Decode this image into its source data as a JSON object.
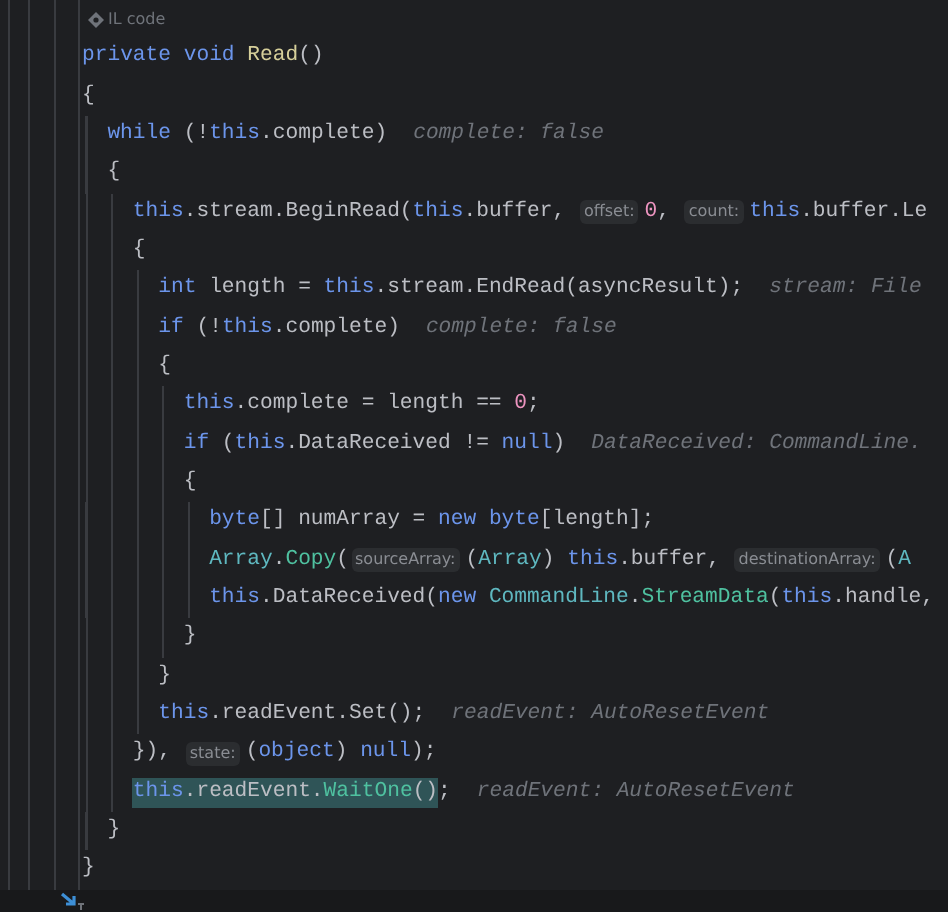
{
  "editor": {
    "code_vision": {
      "text": "IL code"
    },
    "lines": [
      {
        "segments": [
          {
            "kind": "code",
            "tokens": [
              {
                "kind": "kw",
                "text": "private void "
              },
              {
                "kind": "decl",
                "text": "Read"
              },
              {
                "kind": "plain",
                "text": "()"
              }
            ]
          }
        ]
      },
      {
        "segments": [
          {
            "kind": "code",
            "tokens": [
              {
                "kind": "plain",
                "text": "{"
              }
            ]
          }
        ],
        "children": [
          {
            "segments": [
              {
                "kind": "code",
                "tokens": [
                  {
                    "kind": "kw",
                    "text": "while "
                  },
                  {
                    "kind": "plain",
                    "text": "(!"
                  },
                  {
                    "kind": "kw",
                    "text": "this"
                  },
                  {
                    "kind": "plain",
                    "text": ".complete)"
                  }
                ]
              },
              {
                "kind": "value-hint",
                "text": "complete: false"
              }
            ]
          },
          {
            "segments": [
              {
                "kind": "code",
                "tokens": [
                  {
                    "kind": "plain",
                    "text": "{"
                  }
                ]
              }
            ],
            "children": [
              {
                "segments": [
                  {
                    "kind": "code",
                    "tokens": [
                      {
                        "kind": "kw",
                        "text": "this"
                      },
                      {
                        "kind": "plain",
                        "text": ".stream.BeginRead("
                      },
                      {
                        "kind": "kw",
                        "text": "this"
                      },
                      {
                        "kind": "plain",
                        "text": ".buffer, "
                      }
                    ]
                  },
                  {
                    "kind": "param-hint",
                    "text": "offset:"
                  },
                  {
                    "kind": "code",
                    "tokens": [
                      {
                        "kind": "num",
                        "text": "0"
                      },
                      {
                        "kind": "plain",
                        "text": ", "
                      }
                    ]
                  },
                  {
                    "kind": "param-hint",
                    "text": "count:"
                  },
                  {
                    "kind": "code",
                    "tokens": [
                      {
                        "kind": "kw",
                        "text": "this"
                      },
                      {
                        "kind": "plain",
                        "text": ".buffer.Le"
                      }
                    ]
                  }
                ]
              },
              {
                "segments": [
                  {
                    "kind": "code",
                    "tokens": [
                      {
                        "kind": "plain",
                        "text": "{"
                      }
                    ]
                  }
                ],
                "children": [
                  {
                    "segments": [
                      {
                        "kind": "code",
                        "tokens": [
                          {
                            "kind": "kw",
                            "text": "int "
                          },
                          {
                            "kind": "plain",
                            "text": "length = "
                          },
                          {
                            "kind": "kw",
                            "text": "this"
                          },
                          {
                            "kind": "plain",
                            "text": ".stream.EndRead(asyncResult);"
                          }
                        ]
                      },
                      {
                        "kind": "value-hint",
                        "text": "stream: File"
                      }
                    ]
                  },
                  {
                    "segments": [
                      {
                        "kind": "code",
                        "tokens": [
                          {
                            "kind": "kw",
                            "text": "if "
                          },
                          {
                            "kind": "plain",
                            "text": "(!"
                          },
                          {
                            "kind": "kw",
                            "text": "this"
                          },
                          {
                            "kind": "plain",
                            "text": ".complete)"
                          }
                        ]
                      },
                      {
                        "kind": "value-hint",
                        "text": "complete: false"
                      }
                    ]
                  },
                  {
                    "segments": [
                      {
                        "kind": "code",
                        "tokens": [
                          {
                            "kind": "plain",
                            "text": "{"
                          }
                        ]
                      }
                    ],
                    "children": [
                      {
                        "segments": [
                          {
                            "kind": "code",
                            "tokens": [
                              {
                                "kind": "kw",
                                "text": "this"
                              },
                              {
                                "kind": "plain",
                                "text": ".complete = length == "
                              },
                              {
                                "kind": "num",
                                "text": "0"
                              },
                              {
                                "kind": "plain",
                                "text": ";"
                              }
                            ]
                          }
                        ]
                      },
                      {
                        "segments": [
                          {
                            "kind": "code",
                            "tokens": [
                              {
                                "kind": "kw",
                                "text": "if "
                              },
                              {
                                "kind": "plain",
                                "text": "("
                              },
                              {
                                "kind": "kw",
                                "text": "this"
                              },
                              {
                                "kind": "plain",
                                "text": ".DataReceived != "
                              },
                              {
                                "kind": "kw",
                                "text": "null"
                              },
                              {
                                "kind": "plain",
                                "text": ")"
                              }
                            ]
                          },
                          {
                            "kind": "value-hint",
                            "text": "DataReceived: CommandLine."
                          }
                        ]
                      },
                      {
                        "segments": [
                          {
                            "kind": "code",
                            "tokens": [
                              {
                                "kind": "plain",
                                "text": "{"
                              }
                            ]
                          }
                        ],
                        "children": [
                          {
                            "segments": [
                              {
                                "kind": "code",
                                "tokens": [
                                  {
                                    "kind": "kw",
                                    "text": "byte"
                                  },
                                  {
                                    "kind": "plain",
                                    "text": "[] numArray = "
                                  },
                                  {
                                    "kind": "kw",
                                    "text": "new byte"
                                  },
                                  {
                                    "kind": "plain",
                                    "text": "[length];"
                                  }
                                ]
                              }
                            ]
                          },
                          {
                            "segments": [
                              {
                                "kind": "code",
                                "tokens": [
                                  {
                                    "kind": "type",
                                    "text": "Array"
                                  },
                                  {
                                    "kind": "plain",
                                    "text": "."
                                  },
                                  {
                                    "kind": "call",
                                    "text": "Copy"
                                  },
                                  {
                                    "kind": "plain",
                                    "text": "("
                                  }
                                ]
                              },
                              {
                                "kind": "param-hint",
                                "text": "sourceArray:"
                              },
                              {
                                "kind": "code",
                                "tokens": [
                                  {
                                    "kind": "plain",
                                    "text": "("
                                  },
                                  {
                                    "kind": "type",
                                    "text": "Array"
                                  },
                                  {
                                    "kind": "plain",
                                    "text": ") "
                                  },
                                  {
                                    "kind": "kw",
                                    "text": "this"
                                  },
                                  {
                                    "kind": "plain",
                                    "text": ".buffer, "
                                  }
                                ]
                              },
                              {
                                "kind": "param-hint",
                                "text": "destinationArray:"
                              },
                              {
                                "kind": "code",
                                "tokens": [
                                  {
                                    "kind": "plain",
                                    "text": "("
                                  },
                                  {
                                    "kind": "type",
                                    "text": "A"
                                  }
                                ]
                              }
                            ]
                          },
                          {
                            "segments": [
                              {
                                "kind": "code",
                                "tokens": [
                                  {
                                    "kind": "kw",
                                    "text": "this"
                                  },
                                  {
                                    "kind": "plain",
                                    "text": ".DataReceived("
                                  },
                                  {
                                    "kind": "kw",
                                    "text": "new "
                                  },
                                  {
                                    "kind": "type",
                                    "text": "CommandLine"
                                  },
                                  {
                                    "kind": "plain",
                                    "text": "."
                                  },
                                  {
                                    "kind": "call",
                                    "text": "StreamData"
                                  },
                                  {
                                    "kind": "plain",
                                    "text": "("
                                  },
                                  {
                                    "kind": "kw",
                                    "text": "this"
                                  },
                                  {
                                    "kind": "plain",
                                    "text": ".handle,"
                                  }
                                ]
                              }
                            ]
                          }
                        ]
                      },
                      {
                        "segments": [
                          {
                            "kind": "code",
                            "tokens": [
                              {
                                "kind": "plain",
                                "text": "}"
                              }
                            ]
                          }
                        ]
                      }
                    ]
                  },
                  {
                    "segments": [
                      {
                        "kind": "code",
                        "tokens": [
                          {
                            "kind": "plain",
                            "text": "}"
                          }
                        ]
                      }
                    ]
                  },
                  {
                    "segments": [
                      {
                        "kind": "code",
                        "tokens": [
                          {
                            "kind": "kw",
                            "text": "this"
                          },
                          {
                            "kind": "plain",
                            "text": ".readEvent.Set();"
                          }
                        ]
                      },
                      {
                        "kind": "value-hint",
                        "text": "readEvent: AutoResetEvent"
                      }
                    ]
                  }
                ]
              },
              {
                "segments": [
                  {
                    "kind": "code",
                    "tokens": [
                      {
                        "kind": "plain",
                        "text": "}), "
                      }
                    ]
                  },
                  {
                    "kind": "param-hint",
                    "text": "state:"
                  },
                  {
                    "kind": "code",
                    "tokens": [
                      {
                        "kind": "plain",
                        "text": "("
                      },
                      {
                        "kind": "kw",
                        "text": "object"
                      },
                      {
                        "kind": "plain",
                        "text": ") "
                      },
                      {
                        "kind": "kw",
                        "text": "null"
                      },
                      {
                        "kind": "plain",
                        "text": ");"
                      }
                    ]
                  }
                ]
              },
              {
                "segments": [
                  {
                    "kind": "selection",
                    "tokens": [
                      {
                        "kind": "kw",
                        "text": "this"
                      },
                      {
                        "kind": "plain",
                        "text": ".readEvent."
                      },
                      {
                        "kind": "call",
                        "text": "WaitOne"
                      },
                      {
                        "kind": "plain",
                        "text": "()"
                      }
                    ]
                  },
                  {
                    "kind": "code",
                    "tokens": [
                      {
                        "kind": "plain",
                        "text": ";"
                      }
                    ]
                  },
                  {
                    "kind": "value-hint",
                    "text": "readEvent: AutoResetEvent"
                  }
                ]
              }
            ]
          },
          {
            "segments": [
              {
                "kind": "code",
                "tokens": [
                  {
                    "kind": "plain",
                    "text": "}"
                  }
                ]
              }
            ]
          }
        ]
      },
      {
        "segments": [
          {
            "kind": "code",
            "tokens": [
              {
                "kind": "plain",
                "text": "}"
              }
            ]
          }
        ]
      }
    ]
  }
}
